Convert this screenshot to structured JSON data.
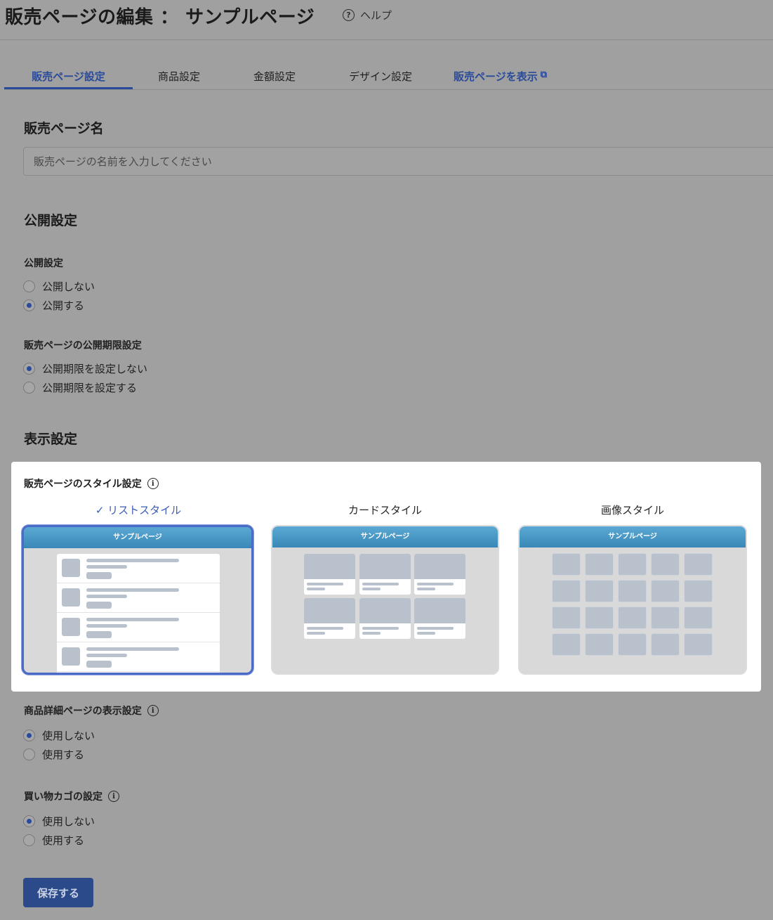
{
  "header": {
    "title": "販売ページの編集 ： サンプルページ",
    "help_label": "ヘルプ"
  },
  "tabs": [
    {
      "label": "販売ページ設定",
      "active": true
    },
    {
      "label": "商品設定",
      "active": false
    },
    {
      "label": "金額設定",
      "active": false
    },
    {
      "label": "デザイン設定",
      "active": false
    },
    {
      "label": "販売ページを表示",
      "active": false,
      "external": true
    }
  ],
  "name_section": {
    "title": "販売ページ名",
    "input_value": "",
    "input_placeholder": "販売ページの名前を入力してください"
  },
  "publish_section": {
    "title": "公開設定",
    "publish": {
      "label": "公開設定",
      "options": [
        "公開しない",
        "公開する"
      ],
      "selected": 1
    },
    "period": {
      "label": "販売ページの公開期限設定",
      "options": [
        "公開期限を設定しない",
        "公開期限を設定する"
      ],
      "selected": 0
    }
  },
  "display_section": {
    "title": "表示設定",
    "style": {
      "label": "販売ページのスタイル設定",
      "options": [
        {
          "name": "リストスタイル",
          "selected": true,
          "preview_title": "サンプルページ"
        },
        {
          "name": "カードスタイル",
          "selected": false,
          "preview_title": "サンプルページ"
        },
        {
          "name": "画像スタイル",
          "selected": false,
          "preview_title": "サンプルページ"
        }
      ],
      "selected_mark": "✓"
    },
    "detail_page": {
      "label": "商品詳細ページの表示設定",
      "options": [
        "使用しない",
        "使用する"
      ],
      "selected": 0
    },
    "cart": {
      "label": "買い物カゴの設定",
      "options": [
        "使用しない",
        "使用する"
      ],
      "selected": 0
    }
  },
  "save_label": "保存する",
  "icons": {
    "help": "question-circle-icon",
    "info": "info-circle-icon",
    "external": "external-link-icon",
    "check": "check-icon"
  },
  "colors": {
    "accent": "#2a4a9a",
    "selected_border": "#4a6cc8",
    "preview_bar": "#4a98c6",
    "overlay": "#a0a0a0"
  }
}
